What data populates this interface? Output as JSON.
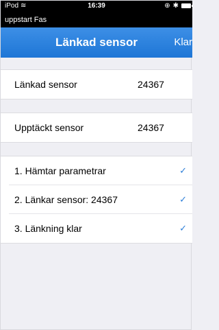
{
  "status_bar": {
    "carrier": "iPod",
    "time": "16:39"
  },
  "app_name": "uppstart Fas",
  "nav": {
    "title": "Länkad sensor",
    "done_label": "Klar"
  },
  "info": [
    {
      "label": "Länkad sensor",
      "value": "24367"
    },
    {
      "label": "Upptäckt sensor",
      "value": "24367"
    }
  ],
  "steps": [
    {
      "label": "1. Hämtar parametrar",
      "done": true
    },
    {
      "label": "2. Länkar sensor: 24367",
      "done": true
    },
    {
      "label": "3. Länkning klar",
      "done": true
    }
  ],
  "colors": {
    "nav_bg": "#1f80df",
    "check": "#2d7fd8",
    "background": "#efeff4"
  }
}
